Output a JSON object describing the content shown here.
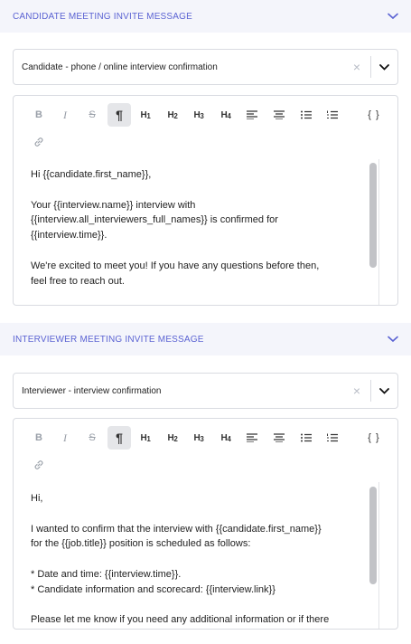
{
  "candidate_section": {
    "title": "CANDIDATE MEETING INVITE MESSAGE",
    "template_select": {
      "value": "Candidate - phone / online interview confirmation",
      "clear_glyph": "×"
    },
    "toolbar": [
      "bold",
      "italic",
      "strikethrough",
      "paragraph",
      "H1",
      "H2",
      "H3",
      "H4",
      "align-left",
      "align-center",
      "bullet-list",
      "ordered-list",
      "code",
      "link"
    ],
    "body_lines": [
      "Hi {{candidate.first_name}},",
      "",
      "Your {{interview.name}} interview with",
      "{{interview.all_interviewers_full_names}} is confirmed for",
      "{{interview.time}}.",
      "",
      "We're excited to meet you! If you have any questions before then,",
      "feel free to reach out."
    ]
  },
  "interviewer_section": {
    "title": "INTERVIEWER MEETING INVITE MESSAGE",
    "template_select": {
      "value": "Interviewer - interview confirmation",
      "clear_glyph": "×"
    },
    "body_lines": [
      "Hi,",
      "",
      "I wanted to confirm that the interview with {{candidate.first_name}}",
      "for the {{job.title}} position is scheduled as follows:",
      "",
      "* Date and time: {{interview.time}}.",
      "* Candidate information and scorecard: {{interview.link}}",
      "",
      "Please let me know if you need any additional information or if there"
    ]
  },
  "toolbar_labels": {
    "bold": "B",
    "italic": "I",
    "strike": "S",
    "paragraph": "¶",
    "h1": "H",
    "h1n": "1",
    "h2": "H",
    "h2n": "2",
    "h3": "H",
    "h3n": "3",
    "h4": "H",
    "h4n": "4",
    "code": "{ }"
  },
  "colors": {
    "accent": "#5b63d3",
    "header_bg": "#f4f5fb",
    "border": "#d9dbe1",
    "active_tool": "#e5e6e9"
  }
}
